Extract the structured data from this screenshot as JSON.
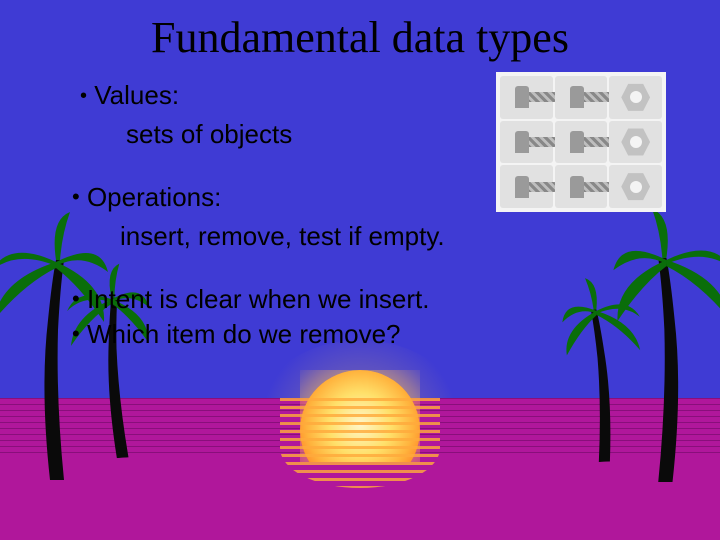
{
  "title": "Fundamental data types",
  "bullets": {
    "values_label": "Values:",
    "values_sub": "sets of objects",
    "operations_label": "Operations:",
    "operations_sub": "insert, remove, test if empty.",
    "intent": "Intent is clear when we insert.",
    "which": "Which item do we remove?"
  },
  "art": {
    "clipart_name": "nuts-and-bolts-clipart",
    "palm_icon": "palm-tree-icon",
    "sun_icon": "sunset-icon"
  },
  "colors": {
    "sky": "#3f3bd4",
    "ocean": "#b0179b",
    "sun_core": "#ffe06a",
    "sun_edge": "#ff7a1a",
    "frond": "#0a6e0a"
  }
}
